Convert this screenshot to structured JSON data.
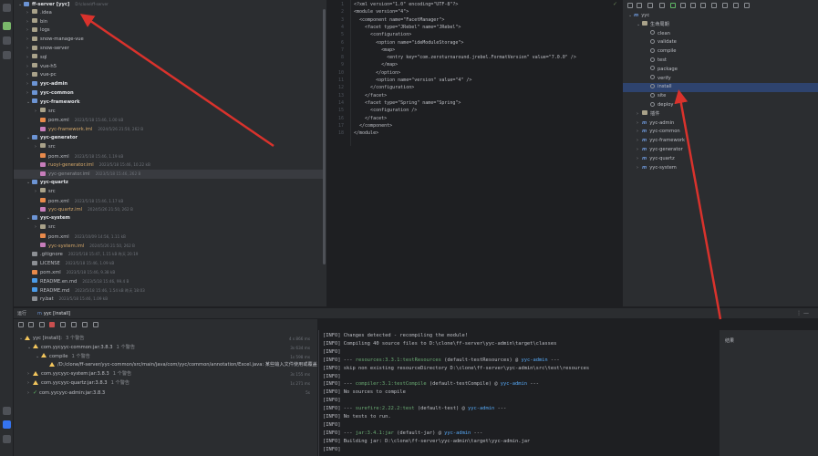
{
  "project_tree": {
    "rows": [
      {
        "name": "ff-server [yyc]",
        "meta": "D:\\clone\\ff-server",
        "level": 0,
        "arrow": "v",
        "icon": "fold mod",
        "bold": true
      },
      {
        "name": ".idea",
        "meta": "",
        "level": 1,
        "arrow": ">",
        "icon": "fold",
        "bold": false
      },
      {
        "name": "bin",
        "meta": "",
        "level": 1,
        "arrow": ">",
        "icon": "fold",
        "bold": false
      },
      {
        "name": "logs",
        "meta": "",
        "level": 1,
        "arrow": ">",
        "icon": "fold",
        "bold": false
      },
      {
        "name": "snow-manage-vue",
        "meta": "",
        "level": 1,
        "arrow": ">",
        "icon": "fold",
        "bold": false
      },
      {
        "name": "snow-server",
        "meta": "",
        "level": 1,
        "arrow": ">",
        "icon": "fold",
        "bold": false
      },
      {
        "name": "sql",
        "meta": "",
        "level": 1,
        "arrow": ">",
        "icon": "fold",
        "bold": false
      },
      {
        "name": "vue-h5",
        "meta": "",
        "level": 1,
        "arrow": ">",
        "icon": "fold",
        "bold": false
      },
      {
        "name": "vue-pc",
        "meta": "",
        "level": 1,
        "arrow": ">",
        "icon": "fold",
        "bold": false
      },
      {
        "name": "yyc-admin",
        "meta": "",
        "level": 1,
        "arrow": ">",
        "icon": "fold mod",
        "bold": true
      },
      {
        "name": "yyc-common",
        "meta": "",
        "level": 1,
        "arrow": ">",
        "icon": "fold mod",
        "bold": true
      },
      {
        "name": "yyc-framework",
        "meta": "",
        "level": 1,
        "arrow": "v",
        "icon": "fold mod",
        "bold": true
      },
      {
        "name": "src",
        "meta": "",
        "level": 2,
        "arrow": ">",
        "icon": "fold",
        "bold": false
      },
      {
        "name": "pom.xml",
        "meta": "2023/5/18 15:46, 1.00 kB",
        "level": 2,
        "arrow": "",
        "icon": "file-xml",
        "bold": false
      },
      {
        "name": "yyc-framework.iml",
        "meta": "2024/5/26 21:50, 262 B",
        "level": 2,
        "arrow": "",
        "icon": "file-iml",
        "bold": false,
        "orange": true
      },
      {
        "name": "yyc-generator",
        "meta": "",
        "level": 1,
        "arrow": "v",
        "icon": "fold mod",
        "bold": true
      },
      {
        "name": "src",
        "meta": "",
        "level": 2,
        "arrow": ">",
        "icon": "fold",
        "bold": false
      },
      {
        "name": "pom.xml",
        "meta": "2023/5/18 15:46, 1.19 kB",
        "level": 2,
        "arrow": "",
        "icon": "file-xml",
        "bold": false
      },
      {
        "name": "ruoyi-generator.iml",
        "meta": "2023/5/18 15:46, 10.22 kB",
        "level": 2,
        "arrow": "",
        "icon": "file-iml",
        "bold": false,
        "orange": true
      },
      {
        "name": "yyc-generator.iml",
        "meta": "2023/5/18 15:46, 262 B",
        "level": 2,
        "arrow": "",
        "icon": "file-iml",
        "bold": false,
        "sel": true,
        "dim": true
      },
      {
        "name": "yyc-quartz",
        "meta": "",
        "level": 1,
        "arrow": "v",
        "icon": "fold mod",
        "bold": true
      },
      {
        "name": "src",
        "meta": "",
        "level": 2,
        "arrow": ">",
        "icon": "fold",
        "bold": false
      },
      {
        "name": "pom.xml",
        "meta": "2023/5/18 15:46, 1.17 kB",
        "level": 2,
        "arrow": "",
        "icon": "file-xml",
        "bold": false
      },
      {
        "name": "yyc-quartz.iml",
        "meta": "2024/5/26 21:50, 262 B",
        "level": 2,
        "arrow": "",
        "icon": "file-iml",
        "bold": false,
        "orange": true
      },
      {
        "name": "yyc-system",
        "meta": "",
        "level": 1,
        "arrow": "v",
        "icon": "fold mod",
        "bold": true
      },
      {
        "name": "src",
        "meta": "",
        "level": 2,
        "arrow": ">",
        "icon": "fold",
        "bold": false
      },
      {
        "name": "pom.xml",
        "meta": "2023/10/09 14:56, 1.11 kB",
        "level": 2,
        "arrow": "",
        "icon": "file-xml",
        "bold": false
      },
      {
        "name": "yyc-system.iml",
        "meta": "2024/5/26 21:50, 262 B",
        "level": 2,
        "arrow": "",
        "icon": "file-iml",
        "bold": false,
        "orange": true
      },
      {
        "name": ".gitignore",
        "meta": "2023/5/18 15:47, 1.15 kB 昨天 20:19",
        "level": 1,
        "arrow": "",
        "icon": "file-txt",
        "bold": false
      },
      {
        "name": "LICENSE",
        "meta": "2023/5/18 15:46, 1.09 kB",
        "level": 1,
        "arrow": "",
        "icon": "file-txt",
        "bold": false
      },
      {
        "name": "pom.xml",
        "meta": "2023/5/18 15:46, 9.38 kB",
        "level": 1,
        "arrow": "",
        "icon": "file-xml",
        "bold": false
      },
      {
        "name": "README.en.md",
        "meta": "2023/5/18 15:46, 99.4 B",
        "level": 1,
        "arrow": "",
        "icon": "file-md",
        "bold": false
      },
      {
        "name": "README.md",
        "meta": "2023/5/18 15:46, 1.54 kB 昨天 18:03",
        "level": 1,
        "arrow": "",
        "icon": "file-md",
        "bold": false
      },
      {
        "name": "ry.bat",
        "meta": "2023/5/18 15:46, 1.09 kB",
        "level": 1,
        "arrow": "",
        "icon": "file-txt",
        "bold": false
      }
    ]
  },
  "editor": {
    "lines": [
      {
        "n": "1",
        "t": "<?xml version=\"1.0\" encoding=\"UTF-8\"?>"
      },
      {
        "n": "2",
        "t": "<module version=\"4\">"
      },
      {
        "n": "3",
        "t": "  <component name=\"FacetManager\">"
      },
      {
        "n": "4",
        "t": "    <facet type=\"JRebel\" name=\"JRebel\">"
      },
      {
        "n": "5",
        "t": "      <configuration>"
      },
      {
        "n": "6",
        "t": "        <option name=\"ideModuleStorage\">"
      },
      {
        "n": "7",
        "t": "          <map>"
      },
      {
        "n": "8",
        "t": "            <entry key=\"com.zeroturnaround.jrebel.FormatVersion\" value=\"7.0.0\" />"
      },
      {
        "n": "9",
        "t": "          </map>"
      },
      {
        "n": "10",
        "t": "        </option>"
      },
      {
        "n": "11",
        "t": "        <option name=\"version\" value=\"4\" />"
      },
      {
        "n": "12",
        "t": "      </configuration>"
      },
      {
        "n": "13",
        "t": "    </facet>"
      },
      {
        "n": "14",
        "t": "    <facet type=\"Spring\" name=\"Spring\">"
      },
      {
        "n": "15",
        "t": "      <configuration />"
      },
      {
        "n": "16",
        "t": "    </facet>"
      },
      {
        "n": "17",
        "t": "  </component>"
      },
      {
        "n": "18",
        "t": "</module>"
      }
    ]
  },
  "maven": {
    "rows": [
      {
        "label": "yyc",
        "level": 0,
        "arrow": "v",
        "kind": "mod"
      },
      {
        "label": "生命周期",
        "level": 1,
        "arrow": "v",
        "kind": "fld"
      },
      {
        "label": "clean",
        "level": 2,
        "arrow": "",
        "kind": "gear"
      },
      {
        "label": "validate",
        "level": 2,
        "arrow": "",
        "kind": "gear"
      },
      {
        "label": "compile",
        "level": 2,
        "arrow": "",
        "kind": "gear"
      },
      {
        "label": "test",
        "level": 2,
        "arrow": "",
        "kind": "gear"
      },
      {
        "label": "package",
        "level": 2,
        "arrow": "",
        "kind": "gear"
      },
      {
        "label": "verify",
        "level": 2,
        "arrow": "",
        "kind": "gear"
      },
      {
        "label": "install",
        "level": 2,
        "arrow": "",
        "kind": "gear",
        "sel": true
      },
      {
        "label": "site",
        "level": 2,
        "arrow": "",
        "kind": "gear"
      },
      {
        "label": "deploy",
        "level": 2,
        "arrow": "",
        "kind": "gear"
      },
      {
        "label": "插件",
        "level": 1,
        "arrow": ">",
        "kind": "fld"
      },
      {
        "label": "yyc-admin",
        "level": 1,
        "arrow": ">",
        "kind": "mod"
      },
      {
        "label": "yyc-common",
        "level": 1,
        "arrow": ">",
        "kind": "mod"
      },
      {
        "label": "yyc-framework",
        "level": 1,
        "arrow": ">",
        "kind": "mod"
      },
      {
        "label": "yyc-generator",
        "level": 1,
        "arrow": ">",
        "kind": "mod"
      },
      {
        "label": "yyc-quartz",
        "level": 1,
        "arrow": ">",
        "kind": "mod"
      },
      {
        "label": "yyc-system",
        "level": 1,
        "arrow": ">",
        "kind": "mod"
      }
    ]
  },
  "bottom_tabs": {
    "build": "运行",
    "install": "yyc [install]"
  },
  "build_tree": {
    "rows": [
      {
        "label": "yyc [install]:",
        "extra": "3 个警告",
        "level": 0,
        "arrow": "v",
        "kind": "warn",
        "time": "4 s 866 ms"
      },
      {
        "label": "com.yycyyc-common:jar:3.8.3",
        "extra": "1 个警告",
        "level": 1,
        "arrow": "v",
        "kind": "warn",
        "time": "3s 634 ms"
      },
      {
        "label": "compile",
        "extra": "1 个警告",
        "level": 2,
        "arrow": "v",
        "kind": "warn",
        "time": "1s 598 ms"
      },
      {
        "label": "/D:/clone/ff-server/yyc-common/src/main/java/com/yyc/common/annotation/Excel.java: 某些输入文件使用或覆盖了已过时的",
        "extra": "",
        "level": 3,
        "arrow": "",
        "kind": "warn",
        "time": ""
      },
      {
        "label": "com.yycyyc-system:jar:3.8.3",
        "extra": "1 个警告",
        "level": 1,
        "arrow": ">",
        "kind": "warn",
        "time": "3s 155 ms"
      },
      {
        "label": "com.yycyyc-quartz:jar:3.8.3",
        "extra": "1 个警告",
        "level": 1,
        "arrow": ">",
        "kind": "warn",
        "time": "1s 271 ms"
      },
      {
        "label": "com.yycyyc-admin:jar:3.8.3",
        "extra": "",
        "level": 1,
        "arrow": ">",
        "kind": "ok",
        "time": "5s"
      }
    ]
  },
  "console": {
    "lines": [
      {
        "pre": "[INFO] ",
        "plug": "",
        "mod": "",
        "rest": "Changes detected - recompiling the module!"
      },
      {
        "pre": "[INFO] ",
        "plug": "",
        "mod": "",
        "rest": "Compiling 40 source files to D:\\clone\\ff-server\\yyc-admin\\target\\classes"
      },
      {
        "pre": "[INFO] ",
        "plug": "",
        "mod": "",
        "rest": ""
      },
      {
        "pre": "[INFO] --- ",
        "plug": "resources:3.3.1:testResources",
        "mod": "yyc-admin",
        "rest": " (default-testResources) @ "
      },
      {
        "pre": "[INFO] ",
        "plug": "",
        "mod": "",
        "rest": "skip non existing resourceDirectory D:\\clone\\ff-server\\yyc-admin\\src\\test\\resources"
      },
      {
        "pre": "[INFO] ",
        "plug": "",
        "mod": "",
        "rest": ""
      },
      {
        "pre": "[INFO] --- ",
        "plug": "compiler:3.1:testCompile",
        "mod": "yyc-admin",
        "rest": " (default-testCompile) @ "
      },
      {
        "pre": "[INFO] ",
        "plug": "",
        "mod": "",
        "rest": "No sources to compile"
      },
      {
        "pre": "[INFO] ",
        "plug": "",
        "mod": "",
        "rest": ""
      },
      {
        "pre": "[INFO] --- ",
        "plug": "surefire:2.22.2:test",
        "mod": "yyc-admin",
        "rest": " (default-test) @ "
      },
      {
        "pre": "[INFO] ",
        "plug": "",
        "mod": "",
        "rest": "No tests to run."
      },
      {
        "pre": "[INFO] ",
        "plug": "",
        "mod": "",
        "rest": ""
      },
      {
        "pre": "[INFO] --- ",
        "plug": "jar:3.4.1:jar",
        "mod": "yyc-admin",
        "rest": " (default-jar) @ "
      },
      {
        "pre": "[INFO] ",
        "plug": "",
        "mod": "",
        "rest": "Building jar: D:\\clone\\ff-server\\yyc-admin\\target\\yyc-admin.jar"
      },
      {
        "pre": "[INFO] ",
        "plug": "",
        "mod": "",
        "rest": ""
      }
    ]
  },
  "right_strip": {
    "label": "结果"
  },
  "colors": {
    "accent": "#3574f0",
    "annotation_arrow": "#d9322c",
    "warning": "#f2c55c",
    "success": "#5fb865"
  }
}
